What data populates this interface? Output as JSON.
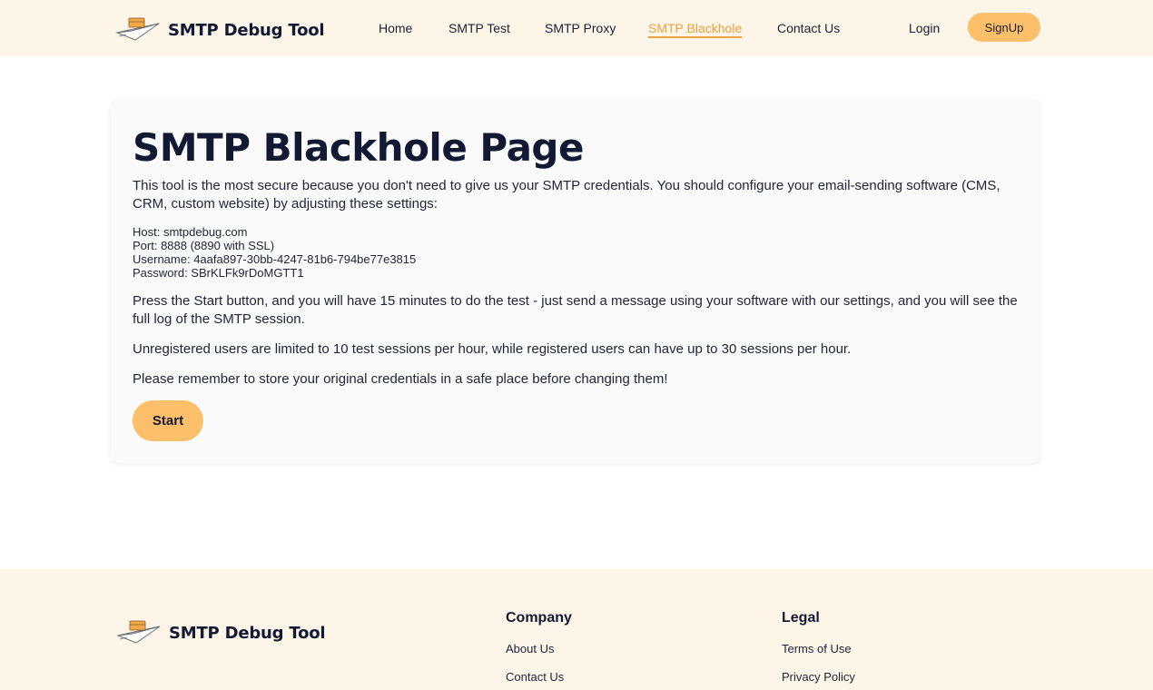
{
  "header": {
    "brand": "SMTP Debug Tool",
    "nav": [
      {
        "label": "Home"
      },
      {
        "label": "SMTP Test"
      },
      {
        "label": "SMTP Proxy"
      },
      {
        "label": "SMTP Blackhole"
      },
      {
        "label": "Contact Us"
      }
    ],
    "login": "Login",
    "signup": "SignUp"
  },
  "main": {
    "title": "SMTP Blackhole Page",
    "intro": "This tool is the most secure because you don't need to give us your SMTP credentials. You should configure your email-sending software (CMS, CRM, custom website) by adjusting these settings:",
    "settings": {
      "host": "Host: smtpdebug.com",
      "port": "Port: 8888 (8890 with SSL)",
      "username": "Username: 4aafa897-30bb-4247-81b6-794be77e3815",
      "password": "Password: SBrKLFk9rDoMGTT1"
    },
    "instructions": "Press the Start button, and you will have 15 minutes to do the test - just send a message using your software with our settings, and you will see the full log of the SMTP session.",
    "limits": "Unregistered users are limited to 10 test sessions per hour, while registered users can have up to 30 sessions per hour.",
    "reminder": "Please remember to store your original credentials in a safe place before changing them!",
    "start_label": "Start"
  },
  "footer": {
    "brand": "SMTP Debug Tool",
    "company_heading": "Company",
    "company_links": [
      "About Us",
      "Contact Us"
    ],
    "legal_heading": "Legal",
    "legal_links": [
      "Terms of Use",
      "Privacy Policy"
    ]
  },
  "colors": {
    "accent": "#fdbf6a",
    "active_link": "#f0a040",
    "header_bg": "#fdf5e8",
    "text_dark": "#121a33"
  }
}
